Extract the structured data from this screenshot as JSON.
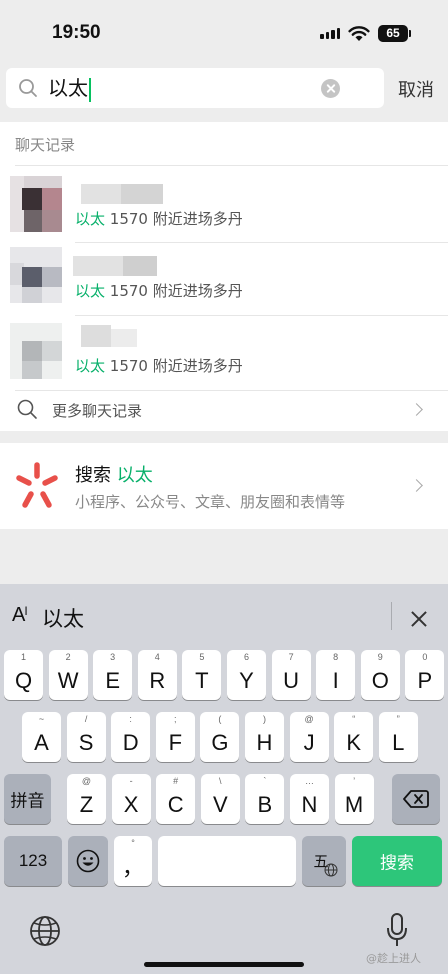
{
  "status_bar": {
    "time": "19:50",
    "battery": "65"
  },
  "search": {
    "query": "以太",
    "cancel_label": "取消"
  },
  "records": {
    "section_title": "聊天记录",
    "items": [
      {
        "match_keyword": "以太",
        "match_rest": " 1570 附近进场多丹"
      },
      {
        "match_keyword": "以太",
        "match_rest": " 1570 附近进场多丹"
      },
      {
        "match_keyword": "以太",
        "match_rest": " 1570 附近进场多丹"
      }
    ],
    "more_label": "更多聊天记录"
  },
  "search_card": {
    "title_prefix": "搜索 ",
    "title_keyword": "以太",
    "subtitle": "小程序、公众号、文章、朋友圈和表情等"
  },
  "keyboard": {
    "ai_label": "A",
    "ai_sup": "I",
    "suggestion": "以太",
    "row1": [
      {
        "k": "Q",
        "h": "1"
      },
      {
        "k": "W",
        "h": "2"
      },
      {
        "k": "E",
        "h": "3"
      },
      {
        "k": "R",
        "h": "4"
      },
      {
        "k": "T",
        "h": "5"
      },
      {
        "k": "Y",
        "h": "6"
      },
      {
        "k": "U",
        "h": "7"
      },
      {
        "k": "I",
        "h": "8"
      },
      {
        "k": "O",
        "h": "9"
      },
      {
        "k": "P",
        "h": "0"
      }
    ],
    "row2": [
      {
        "k": "A",
        "h": "~"
      },
      {
        "k": "S",
        "h": "/"
      },
      {
        "k": "D",
        "h": ":"
      },
      {
        "k": "F",
        "h": ";"
      },
      {
        "k": "G",
        "h": "("
      },
      {
        "k": "H",
        "h": ")"
      },
      {
        "k": "J",
        "h": "@"
      },
      {
        "k": "K",
        "h": "“"
      },
      {
        "k": "L",
        "h": "”"
      }
    ],
    "row3": [
      {
        "k": "Z",
        "h": "@"
      },
      {
        "k": "X",
        "h": "-"
      },
      {
        "k": "C",
        "h": "#"
      },
      {
        "k": "V",
        "h": "\\"
      },
      {
        "k": "B",
        "h": "`"
      },
      {
        "k": "N",
        "h": "…"
      },
      {
        "k": "M",
        "h": "’"
      }
    ],
    "pinyin_label": "拼音",
    "num_label": "123",
    "comma_label": "，",
    "comma_hint": "°",
    "wubi_label": "五",
    "search_key_label": "搜索"
  },
  "watermark": "@趁上进人"
}
